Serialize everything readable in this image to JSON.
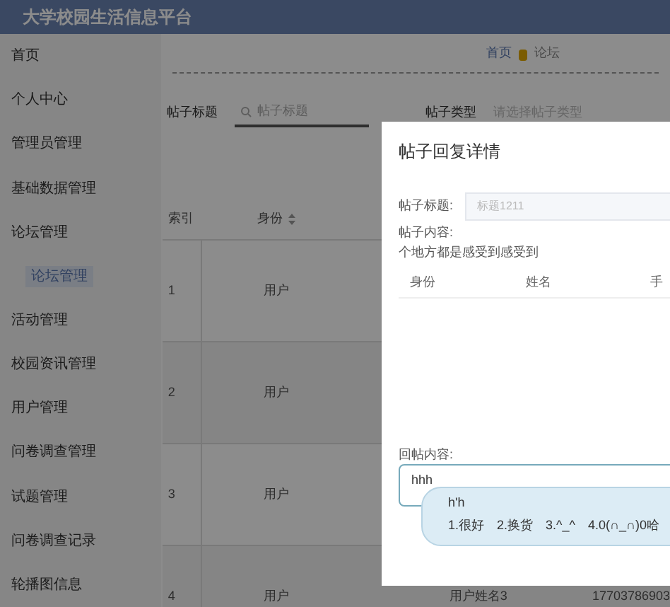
{
  "header": {
    "title": "大学校园生活信息平台"
  },
  "sidebar": {
    "items": [
      {
        "label": "首页"
      },
      {
        "label": "个人中心"
      },
      {
        "label": "管理员管理"
      },
      {
        "label": "基础数据管理"
      },
      {
        "label": "论坛管理",
        "children": [
          {
            "label": "论坛管理",
            "selected": true
          }
        ]
      },
      {
        "label": "活动管理"
      },
      {
        "label": "校园资讯管理"
      },
      {
        "label": "用户管理"
      },
      {
        "label": "问卷调查管理"
      },
      {
        "label": "试题管理"
      },
      {
        "label": "问卷调查记录"
      },
      {
        "label": "轮播图信息"
      }
    ]
  },
  "breadcrumb": [
    "首页",
    "论坛"
  ],
  "search": {
    "title_label": "帖子标题",
    "title_placeholder": "帖子标题",
    "type_label": "帖子类型",
    "type_placeholder": "请选择帖子类型"
  },
  "table": {
    "columns": [
      "索引",
      "身份"
    ],
    "rows": [
      {
        "index": "1",
        "role": "用户"
      },
      {
        "index": "2",
        "role": "用户"
      },
      {
        "index": "3",
        "role": "用户"
      },
      {
        "index": "4",
        "role": "用户",
        "name": "用户姓名3",
        "phone": "17703786903"
      }
    ]
  },
  "dialog": {
    "title": "帖子回复详情",
    "title_label": "帖子标题:",
    "title_value": "标题1211",
    "content_label": "帖子内容:",
    "content": "个地方都是感受到感受到",
    "columns": [
      "身份",
      "姓名",
      "手"
    ],
    "reply_label": "回帖内容:",
    "reply_value": "hhh"
  },
  "ime": {
    "composition": "h'h",
    "candidates": [
      "1.很好",
      "2.换货",
      "3.^_^",
      "4.0(∩_∩)0哈"
    ]
  }
}
